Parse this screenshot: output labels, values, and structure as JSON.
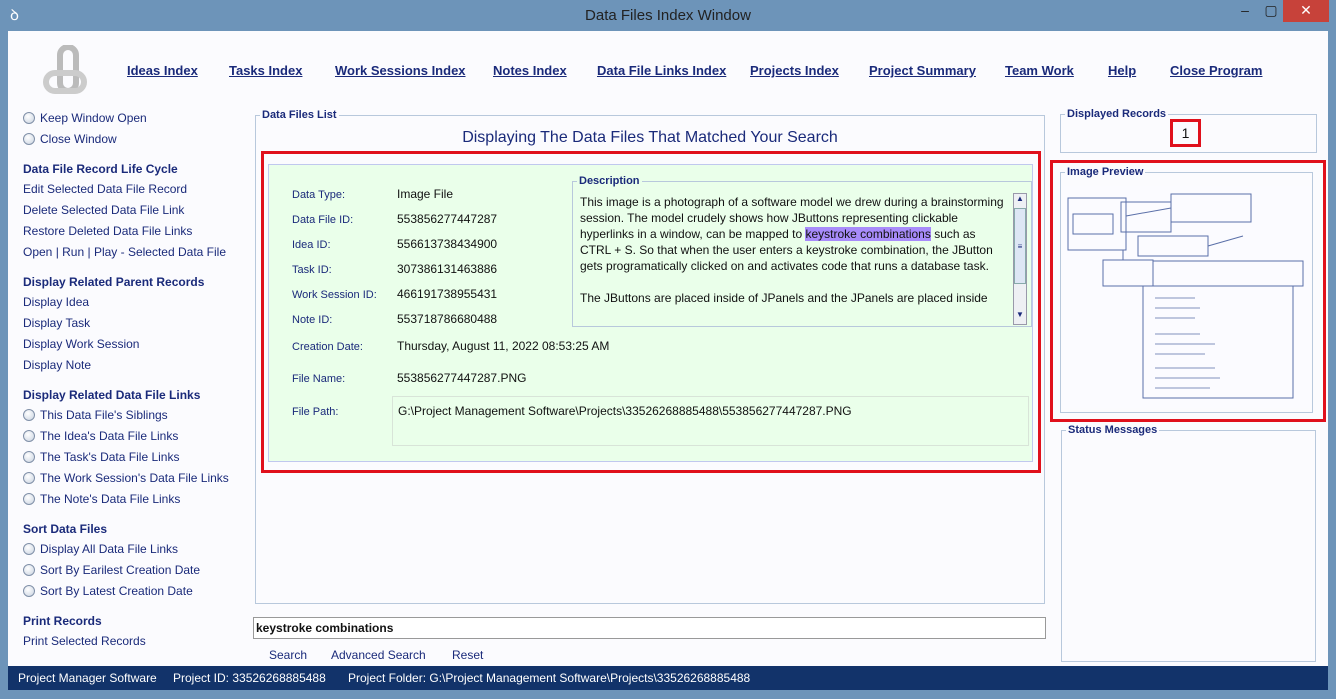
{
  "window": {
    "title": "Data Files Index Window",
    "minimize": "–",
    "maximize": "▢",
    "close": "✕"
  },
  "menu": [
    "Ideas Index",
    "Tasks Index",
    "Work Sessions Index",
    "Notes Index",
    "Data File Links Index",
    "Projects Index",
    "Project Summary",
    "Team Work",
    "Help",
    "Close Program"
  ],
  "sidebar": {
    "window_options": [
      "Keep Window Open",
      "Close Window"
    ],
    "life_cycle": {
      "heading": "Data File Record Life Cycle",
      "items": [
        "Edit Selected Data File Record",
        "Delete Selected Data File Link",
        "Restore Deleted Data File Links",
        "Open | Run | Play - Selected Data File"
      ]
    },
    "parents": {
      "heading": "Display Related Parent Records",
      "items": [
        "Display Idea",
        "Display Task",
        "Display Work Session",
        "Display Note"
      ]
    },
    "links": {
      "heading": "Display Related Data File Links",
      "items": [
        "This Data File's Siblings",
        "The Idea's Data File Links",
        "The Task's Data File Links",
        "The Work Session's Data File Links",
        "The Note's Data File Links"
      ]
    },
    "sort": {
      "heading": "Sort Data Files",
      "items": [
        "Display All Data File Links",
        "Sort By Earilest Creation Date",
        "Sort By Latest Creation Date"
      ]
    },
    "print": {
      "heading": "Print Records",
      "items": [
        "Print Selected Records"
      ]
    }
  },
  "list": {
    "legend": "Data Files List",
    "heading": "Displaying The Data Files That Matched Your Search",
    "record": {
      "fields": [
        [
          "Data Type:",
          "Image File"
        ],
        [
          "Data File ID:",
          "553856277447287"
        ],
        [
          "Idea ID:",
          "556613738434900"
        ],
        [
          "Task ID:",
          "307386131463886"
        ],
        [
          "Work Session ID:",
          "466191738955431"
        ],
        [
          "Note ID:",
          "553718786680488"
        ],
        [
          "Creation Date:",
          "Thursday, August 11, 2022   08:53:25 AM"
        ],
        [
          "File Name:",
          "553856277447287.PNG"
        ],
        [
          "File Path:",
          "G:\\Project Management Software\\Projects\\33526268885488\\553856277447287.PNG"
        ]
      ],
      "description_legend": "Description",
      "description_pre": "This image is a photograph of a software model we drew during a brainstorming session. The model crudely shows how JButtons representing clickable hyperlinks in a window, can be mapped to ",
      "description_hl": "keystroke combinations",
      "description_post": " such as CTRL + S. So that when the user enters a keystroke combination, the JButton gets programatically clicked on and activates code that runs a database task.",
      "description_p2": "The JButtons are placed inside of JPanels and the JPanels are placed inside"
    }
  },
  "search": {
    "value": "keystroke combinations",
    "search": "Search",
    "advanced": "Advanced Search",
    "reset": "Reset"
  },
  "displayed": {
    "legend": "Displayed Records",
    "count": "1"
  },
  "preview": {
    "legend": "Image Preview"
  },
  "messages": {
    "legend": "Status Messages"
  },
  "statusbar": {
    "app": "Project Manager Software",
    "project_id": "Project ID:  33526268885488",
    "folder": "Project Folder:  G:\\Project Management Software\\Projects\\33526268885488"
  }
}
